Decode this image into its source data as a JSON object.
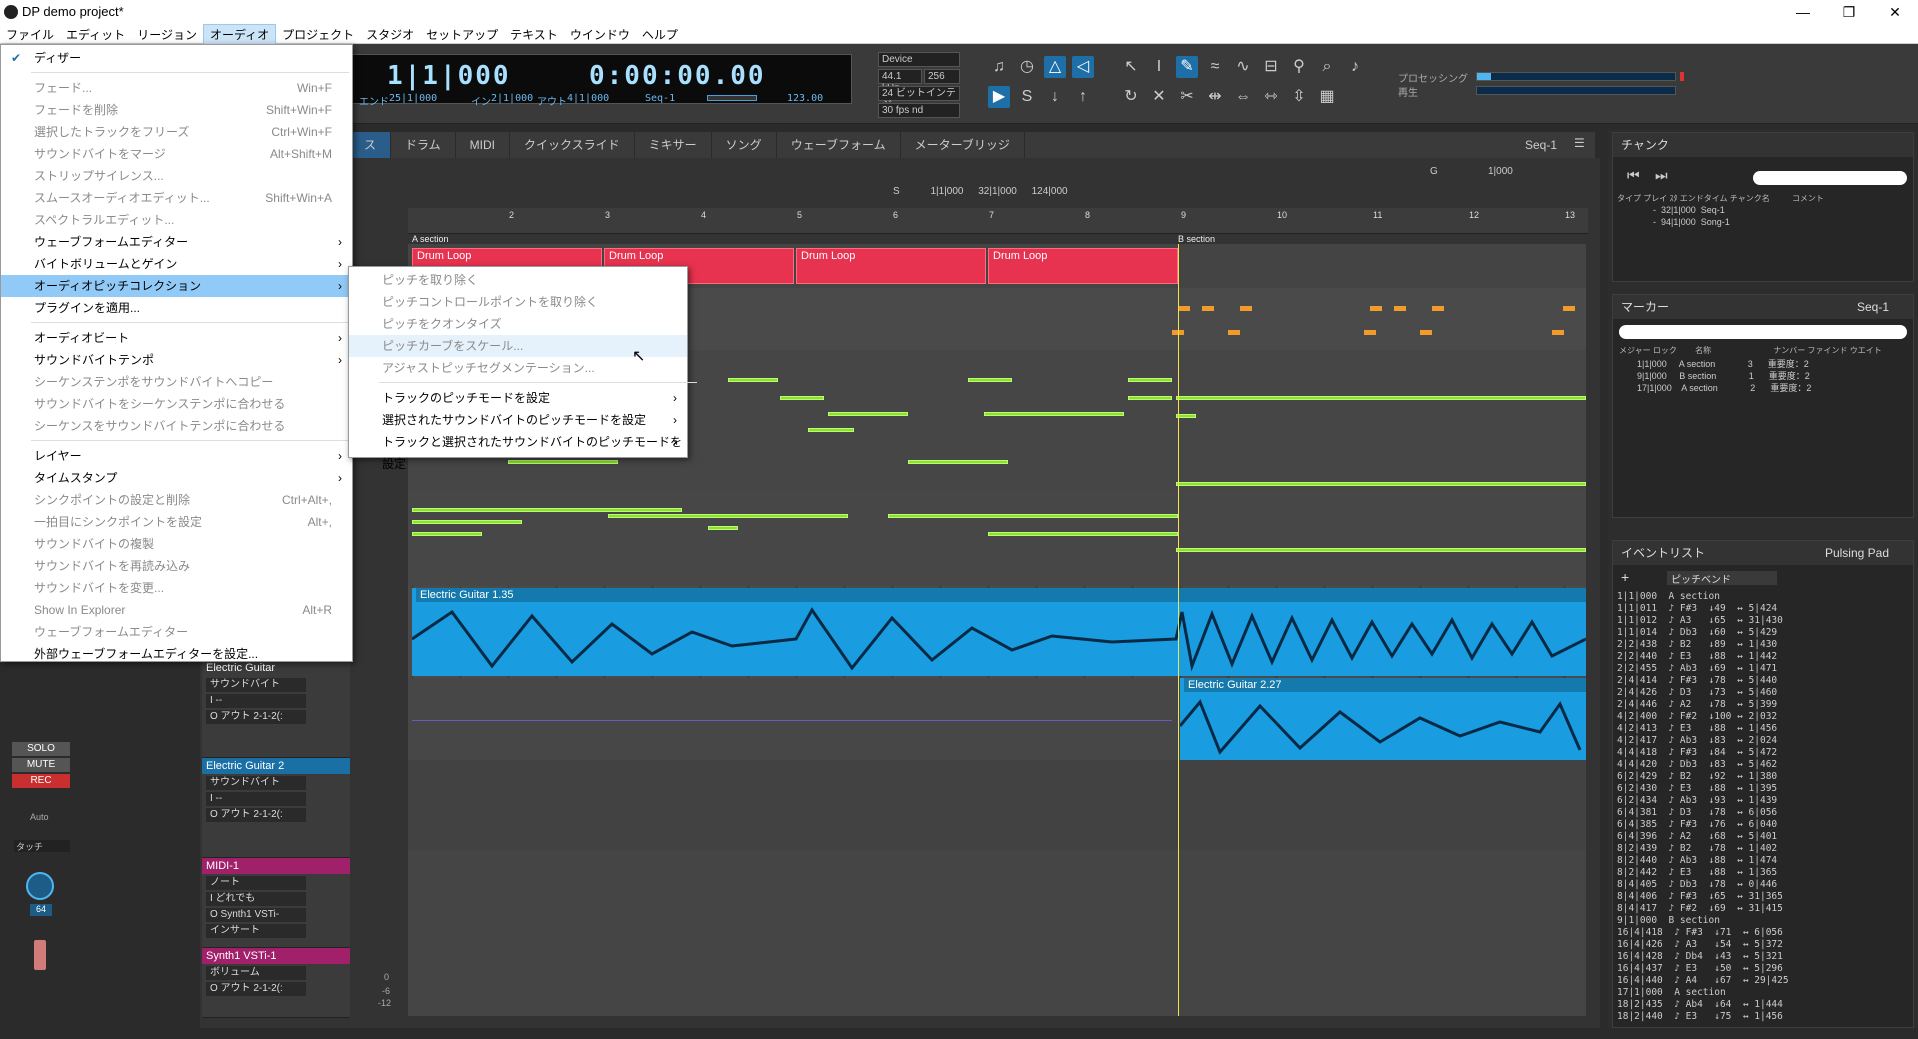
{
  "window": {
    "title": "DP demo project*",
    "minimize": "—",
    "maximize": "❐",
    "close": "✕"
  },
  "menubar": [
    "ファイル",
    "エディット",
    "リージョン",
    "オーディオ",
    "プロジェクト",
    "スタジオ",
    "セットアップ",
    "テキスト",
    "ウインドウ",
    "ヘルプ"
  ],
  "transport": {
    "counter_bars": "1|1|000",
    "counter_time": "0:00:00.00",
    "end_label": "エンド",
    "end_value": "25|1|000",
    "in_label": "イン",
    "in_value": "2|1|000",
    "out_label": "アウト",
    "out_value": "4|1|000",
    "seq": "Seq-1",
    "tempo": "123.00",
    "device": "Device",
    "sample_rate": "44.1 kHz",
    "buffer": "256",
    "bit_depth": "24 ビットインテジ",
    "frame_rate": "30 fps nd",
    "processing_label": "プロセッシング",
    "play_label": "再生"
  },
  "tabs": [
    "ス",
    "ドラム",
    "MIDI",
    "クイックスライド",
    "ミキサー",
    "ソング",
    "ウェーブフォーム",
    "メーターブリッジ"
  ],
  "tab_right": "Seq-1",
  "locator": {
    "s": "S",
    "start": "1|1|000",
    "end": "32|1|000",
    "len": "124|000"
  },
  "grid": {
    "g": "G",
    "val": "1|000"
  },
  "ruler_marks": [
    "2",
    "3",
    "4",
    "5",
    "6",
    "7",
    "8",
    "9",
    "10",
    "11",
    "12",
    "13"
  ],
  "markers": {
    "a": "A section",
    "b": "B section"
  },
  "drum_clips": [
    "Drum Loop",
    "Drum Loop",
    "Drum Loop",
    "Drum Loop"
  ],
  "audio_clips": {
    "eg1": "Electric Guitar 1.35",
    "eg2": "Electric Guitar 2.27"
  },
  "track_headers": [
    {
      "name": "Electric Guitar",
      "rows": [
        "サウンドバイト",
        "I --",
        "O アウト 2-1-2(:"
      ]
    },
    {
      "name": "Electric Guitar 2",
      "rows": [
        "サウンドバイト",
        "I --",
        "O アウト 2-1-2(:"
      ]
    },
    {
      "name": "MIDI-1",
      "rows": [
        "ノート",
        "I どれでも",
        "O Synth1 VSTi-"
      ]
    },
    {
      "name": "Synth1 VSTi-1",
      "rows": [
        "ボリューム",
        "O アウト 2-1-2(:"
      ]
    }
  ],
  "insert_label": "インサート",
  "left_controls": {
    "solo": "SOLO",
    "mute": "MUTE",
    "rec": "REC",
    "auto": "Auto",
    "touch": "タッチ",
    "pan": "64"
  },
  "db_scale": [
    "0",
    "-6",
    "-12"
  ],
  "audio_menu": {
    "items": [
      {
        "label": "ディザー",
        "checked": true,
        "disabled": false
      },
      {
        "sep": true
      },
      {
        "label": "フェード...",
        "shortcut": "Win+F",
        "disabled": true
      },
      {
        "label": "フェードを削除",
        "shortcut": "Shift+Win+F",
        "disabled": true
      },
      {
        "label": "選択したトラックをフリーズ",
        "shortcut": "Ctrl+Win+F",
        "disabled": true
      },
      {
        "label": "サウンドバイトをマージ",
        "shortcut": "Alt+Shift+M",
        "disabled": true
      },
      {
        "label": "ストリップサイレンス...",
        "disabled": true
      },
      {
        "label": "スムースオーディオエディット...",
        "shortcut": "Shift+Win+A",
        "disabled": true
      },
      {
        "label": "スペクトラルエディット...",
        "disabled": true
      },
      {
        "label": "ウェーブフォームエディター",
        "submenu": true,
        "disabled": false
      },
      {
        "label": "バイトボリュームとゲイン",
        "submenu": true,
        "disabled": false
      },
      {
        "label": "オーディオピッチコレクション",
        "submenu": true,
        "disabled": false,
        "selected": true
      },
      {
        "label": "プラグインを適用...",
        "disabled": false
      },
      {
        "sep": true
      },
      {
        "label": "オーディオビート",
        "submenu": true,
        "disabled": false
      },
      {
        "label": "サウンドバイトテンポ",
        "submenu": true,
        "disabled": false
      },
      {
        "label": "シーケンステンポをサウンドバイトへコピー",
        "disabled": true
      },
      {
        "label": "サウンドバイトをシーケンステンポに合わせる",
        "disabled": true
      },
      {
        "label": "シーケンスをサウンドバイトテンポに合わせる",
        "disabled": true
      },
      {
        "sep": true
      },
      {
        "label": "レイヤー",
        "submenu": true,
        "disabled": false
      },
      {
        "label": "タイムスタンプ",
        "submenu": true,
        "disabled": false
      },
      {
        "label": "シンクポイントの設定と削除",
        "shortcut": "Ctrl+Alt+,",
        "disabled": true
      },
      {
        "label": "一拍目にシンクポイントを設定",
        "shortcut": "Alt+,",
        "disabled": true
      },
      {
        "label": "サウンドバイトの複製",
        "disabled": true
      },
      {
        "label": "サウンドバイトを再読み込み",
        "disabled": true
      },
      {
        "label": "サウンドバイトを変更...",
        "disabled": true
      },
      {
        "label": "Show In Explorer",
        "shortcut": "Alt+R",
        "disabled": true
      },
      {
        "label": "ウェーブフォームエディター",
        "disabled": true
      },
      {
        "label": "外部ウェーブフォームエディターを設定...",
        "disabled": false
      }
    ]
  },
  "pitch_submenu": {
    "items": [
      {
        "label": "ピッチを取り除く",
        "disabled": true
      },
      {
        "label": "ピッチコントロールポイントを取り除く",
        "disabled": true
      },
      {
        "label": "ピッチをクオンタイズ",
        "disabled": true
      },
      {
        "label": "ピッチカーブをスケール...",
        "disabled": true,
        "hover": true
      },
      {
        "label": "アジャストピッチセグメンテーション...",
        "disabled": true
      },
      {
        "sep": true
      },
      {
        "label": "トラックのピッチモードを設定",
        "submenu": true
      },
      {
        "label": "選択されたサウンドバイトのピッチモードを設定",
        "submenu": true
      },
      {
        "label": "トラックと選択されたサウンドバイトのピッチモードを設定",
        "submenu": true
      }
    ]
  },
  "chunks_panel": {
    "title": "チャンク",
    "cols": [
      "タイプ",
      "プレイ",
      "ｽﾀ",
      "エンドタイム",
      "チャンク名",
      "コメント"
    ],
    "rows": [
      [
        "-",
        "32|1|000",
        "Seq-1"
      ],
      [
        "-",
        "94|1|000",
        "Song-1"
      ]
    ]
  },
  "markers_panel": {
    "title": "マーカー",
    "seq": "Seq-1",
    "cols": [
      "メジャー",
      "ロック",
      "名称",
      "ナンバー",
      "ファインド",
      "ウエイト"
    ],
    "rows": [
      [
        "1|1|000",
        "A section",
        "3",
        "重要度：2"
      ],
      [
        "9|1|000",
        "B section",
        "1",
        "重要度：2"
      ],
      [
        "17|1|000",
        "A section",
        "2",
        "重要度：2"
      ]
    ]
  },
  "events_panel": {
    "title": "イベントリスト",
    "track": "Pulsing Pad",
    "filter": "ピッチベンド",
    "rows": [
      "1|1|000  A section",
      "1|1|011  ♪ F#3  ↓49  ↔ 5|424",
      "1|1|012  ♪ A3   ↓65  ↔ 31|430",
      "1|1|014  ♪ Db3  ↓60  ↔ 5|429",
      "2|2|438  ♪ B2   ↓89  ↔ 1|430",
      "2|2|440  ♪ E3   ↓88  ↔ 1|442",
      "2|2|455  ♪ Ab3  ↓69  ↔ 1|471",
      "2|4|414  ♪ F#3  ↓78  ↔ 5|440",
      "2|4|426  ♪ D3   ↓73  ↔ 5|460",
      "2|4|446  ♪ A2   ↓78  ↔ 5|399",
      "4|2|400  ♪ F#2  ↓100 ↔ 2|032",
      "4|2|413  ♪ E3   ↓88  ↔ 1|456",
      "4|2|417  ♪ Ab3  ↓83  ↔ 2|024",
      "4|4|418  ♪ F#3  ↓84  ↔ 5|472",
      "4|4|420  ♪ Db3  ↓83  ↔ 5|462",
      "6|2|429  ♪ B2   ↓92  ↔ 1|380",
      "6|2|430  ♪ E3   ↓88  ↔ 1|395",
      "6|2|434  ♪ Ab3  ↓93  ↔ 1|439",
      "6|4|381  ♪ D3   ↓78  ↔ 6|056",
      "6|4|385  ♪ F#3  ↓76  ↔ 6|040",
      "6|4|396  ♪ A2   ↓68  ↔ 5|401",
      "8|2|439  ♪ B2   ↓78  ↔ 1|402",
      "8|2|440  ♪ Ab3  ↓88  ↔ 1|474",
      "8|2|442  ♪ E3   ↓88  ↔ 1|365",
      "8|4|405  ♪ Db3  ↓78  ↔ 0|446",
      "8|4|406  ♪ F#3  ↓65  ↔ 31|365",
      "8|4|417  ♪ F#2  ↓69  ↔ 31|415",
      "9|1|000  B section",
      "16|4|418  ♪ F#3  ↓71  ↔ 6|056",
      "16|4|426  ♪ A3   ↓54  ↔ 5|372",
      "16|4|428  ♪ Db4  ↓43  ↔ 5|321",
      "16|4|437  ♪ E3   ↓50  ↔ 5|296",
      "16|4|440  ♪ A4   ↓67  ↔ 29|425",
      "17|1|000  A section",
      "18|2|435  ♪ Ab4  ↓64  ↔ 1|444",
      "18|2|440  ♪ E3   ↓75  ↔ 1|456"
    ]
  }
}
